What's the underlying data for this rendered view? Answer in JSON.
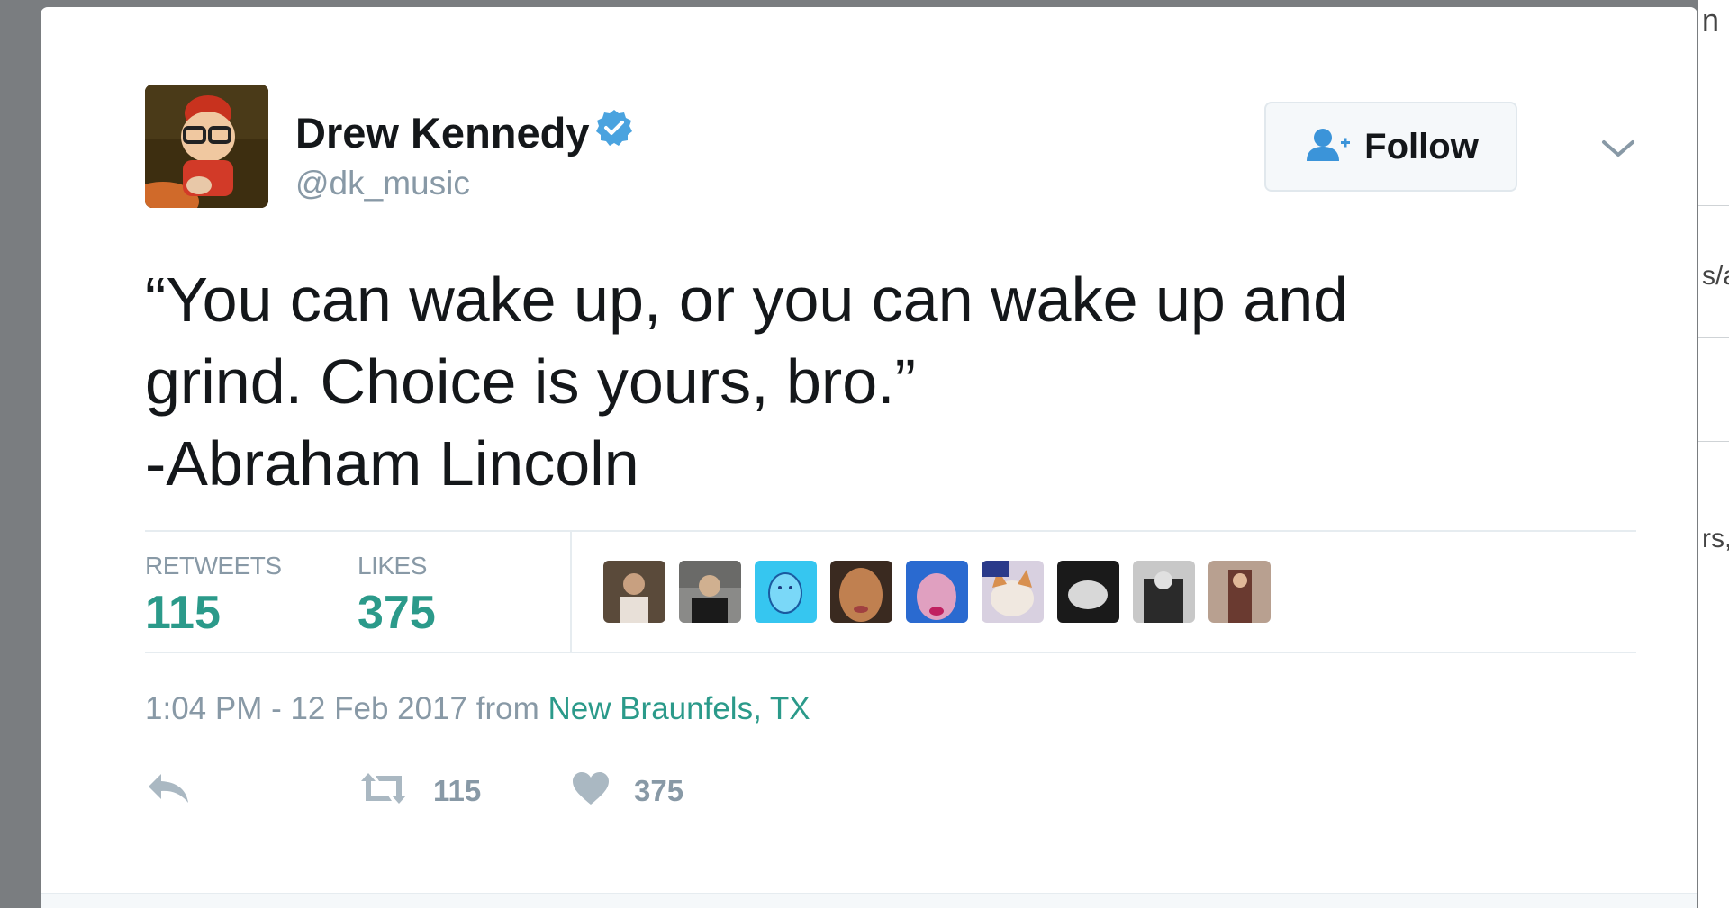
{
  "tweet": {
    "author": {
      "display_name": "Drew Kennedy",
      "handle": "@dk_music",
      "verified": true
    },
    "follow_button": {
      "label": "Follow",
      "icon": "follow-user-icon"
    },
    "menu_icon": "chevron-down-icon",
    "text_lines": [
      "“You can wake up, or you can wake up and",
      "grind. Choice is yours, bro.”",
      "-Abraham Lincoln"
    ],
    "stats": {
      "retweets_label": "RETWEETS",
      "retweets_value": "115",
      "likes_label": "LIKES",
      "likes_value": "375"
    },
    "liker_avatars": [
      {
        "icon": "avatar-1",
        "color": "#5a4a3a"
      },
      {
        "icon": "avatar-2",
        "color": "#4a4a4a"
      },
      {
        "icon": "avatar-3",
        "color": "#36c6f0"
      },
      {
        "icon": "avatar-4",
        "color": "#8a5a3a"
      },
      {
        "icon": "avatar-5",
        "color": "#3a6ad0"
      },
      {
        "icon": "avatar-6",
        "color": "#b0a8a0"
      },
      {
        "icon": "avatar-7",
        "color": "#6a6a6a"
      },
      {
        "icon": "avatar-8",
        "color": "#5a5a5a"
      },
      {
        "icon": "avatar-9",
        "color": "#7a5a4a"
      }
    ],
    "timestamp": "1:04 PM - 12 Feb 2017",
    "from_label": "from",
    "location": "New Braunfels, TX",
    "actions": {
      "reply_icon": "reply-icon",
      "retweet_icon": "retweet-icon",
      "retweet_count": "115",
      "like_icon": "heart-icon",
      "like_count": "375"
    }
  },
  "background": {
    "right_fragments": [
      "n",
      "s/a",
      "rs,"
    ]
  },
  "colors": {
    "accent": "#2b9a8a",
    "verified": "#4aa3df",
    "muted": "#8899a6",
    "text": "#14171a",
    "backdrop": "#7a7d80"
  }
}
